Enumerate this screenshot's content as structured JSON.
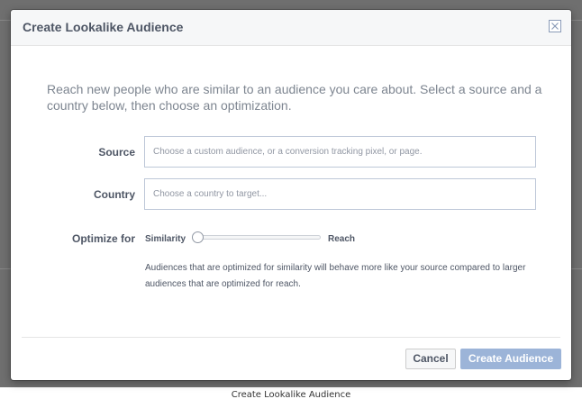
{
  "dialog": {
    "title": "Create Lookalike Audience",
    "close_icon": "close-icon",
    "intro": "Reach new people who are similar to an audience you care about. Select a source and a country below, then choose an optimization."
  },
  "form": {
    "source": {
      "label": "Source",
      "value": "",
      "placeholder": "Choose a custom audience, or a conversion tracking pixel, or page."
    },
    "country": {
      "label": "Country",
      "value": "",
      "placeholder": "Choose a country to target..."
    },
    "optimize": {
      "label": "Optimize for",
      "min_label": "Similarity",
      "max_label": "Reach",
      "value": 0,
      "help": "Audiences that are optimized for similarity will behave more like your source compared to larger audiences that are optimized for reach."
    }
  },
  "footer": {
    "cancel_label": "Cancel",
    "create_label": "Create Audience"
  },
  "caption": "Create Lookalike Audience",
  "colors": {
    "primary_disabled": "#9cb4d8",
    "header_bg": "#f6f7f8",
    "text_dark": "#4e5665",
    "text_muted": "#7d8590",
    "backdrop": "#6f6f6f"
  }
}
